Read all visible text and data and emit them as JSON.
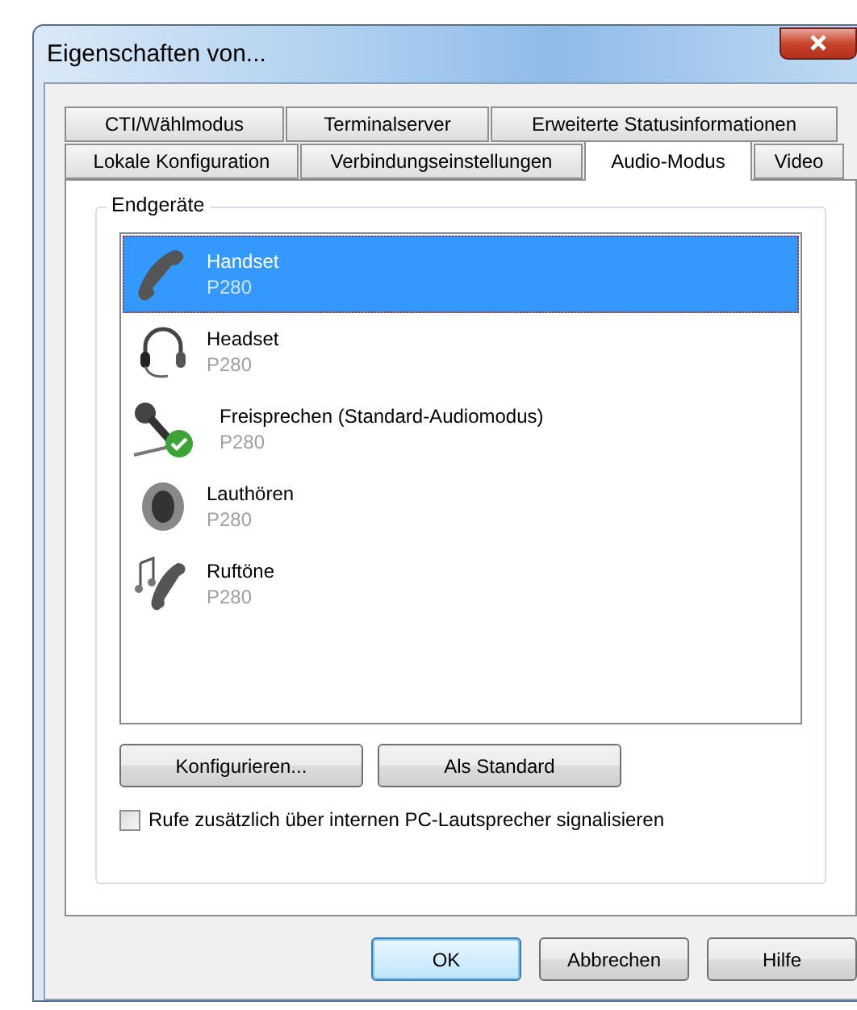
{
  "window": {
    "title": "Eigenschaften von..."
  },
  "tab_rows": [
    [
      {
        "label": "CTI/Wählmodus",
        "selected": false
      },
      {
        "label": "Terminalserver",
        "selected": false
      },
      {
        "label": "Erweiterte Statusinformationen",
        "selected": false
      }
    ],
    [
      {
        "label": "Lokale Konfiguration",
        "selected": false
      },
      {
        "label": "Verbindungseinstellungen",
        "selected": false
      },
      {
        "label": "Audio-Modus",
        "selected": true
      },
      {
        "label": "Video",
        "selected": false
      }
    ]
  ],
  "group": {
    "title": "Endgeräte"
  },
  "devices": [
    {
      "kind": "handset",
      "name": "Handset",
      "model": "P280",
      "selected": true,
      "default": false
    },
    {
      "kind": "headset",
      "name": "Headset",
      "model": "P280",
      "selected": false,
      "default": false
    },
    {
      "kind": "microphone",
      "name": "Freisprechen (Standard-Audiomodus)",
      "model": "P280",
      "selected": false,
      "default": true
    },
    {
      "kind": "speaker",
      "name": "Lauthören",
      "model": "P280",
      "selected": false,
      "default": false
    },
    {
      "kind": "ringtones",
      "name": "Ruftöne",
      "model": "P280",
      "selected": false,
      "default": false
    }
  ],
  "actions": [
    "Konfigurieren...",
    "Als Standard"
  ],
  "option": {
    "label": "Rufe zusätzlich über internen PC-Lautsprecher signalisieren",
    "checked": false
  },
  "buttons": [
    {
      "label": "OK",
      "default": true
    },
    {
      "label": "Abbrechen",
      "default": false
    },
    {
      "label": "Hilfe",
      "default": false
    }
  ]
}
